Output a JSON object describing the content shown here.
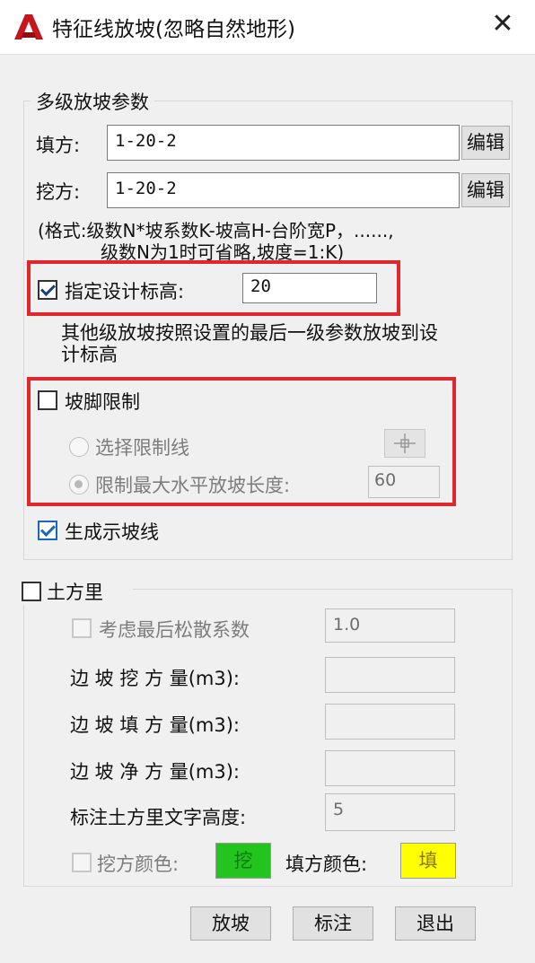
{
  "window": {
    "title": "特征线放坡(忽略自然地形)"
  },
  "slope_params": {
    "legend": "多级放坡参数",
    "fill_label": "填方:",
    "fill_value": "1-20-2",
    "cut_label": "挖方:",
    "cut_value": "1-20-2",
    "edit_label": "编辑",
    "format_line1": "(格式:级数N*坡系数K-坡高H-台阶宽P，......,",
    "format_line2": "级数N为1时可省略,坡度=1:K)",
    "design_elev_label": "指定设计标高:",
    "design_elev_value": "20",
    "design_elev_checked": true,
    "elev_note_line1": "其他级放坡按照设置的最后一级参数放坡到设",
    "elev_note_line2": "计标高",
    "toe_limit_label": "坡脚限制",
    "toe_limit_checked": false,
    "select_line_label": "选择限制线",
    "max_len_label": "限制最大水平放坡长度:",
    "max_len_value": "60",
    "show_slope_label": "生成示坡线",
    "show_slope_checked": true
  },
  "earthwork": {
    "legend": "土方里",
    "checked": false,
    "loose_label": "考虑最后松散系数",
    "loose_value": "1.0",
    "cut_vol_label": "边 坡 挖 方 量(m3):",
    "fill_vol_label": "边 坡 填 方 量(m3):",
    "net_vol_label": "边 坡 净 方 量(m3):",
    "text_height_label": "标注土方里文字高度:",
    "text_height_value": "5",
    "cut_color_label": "挖方颜色:",
    "cut_color_text": "挖",
    "cut_color": "#22c41d",
    "fill_color_label": "填方颜色:",
    "fill_color_text": "填",
    "fill_color": "#ffff00"
  },
  "buttons": {
    "slope": "放坡",
    "annotate": "标注",
    "exit": "退出"
  },
  "colors": {
    "highlight": "#e0282c",
    "app_red": "#c4161c"
  }
}
